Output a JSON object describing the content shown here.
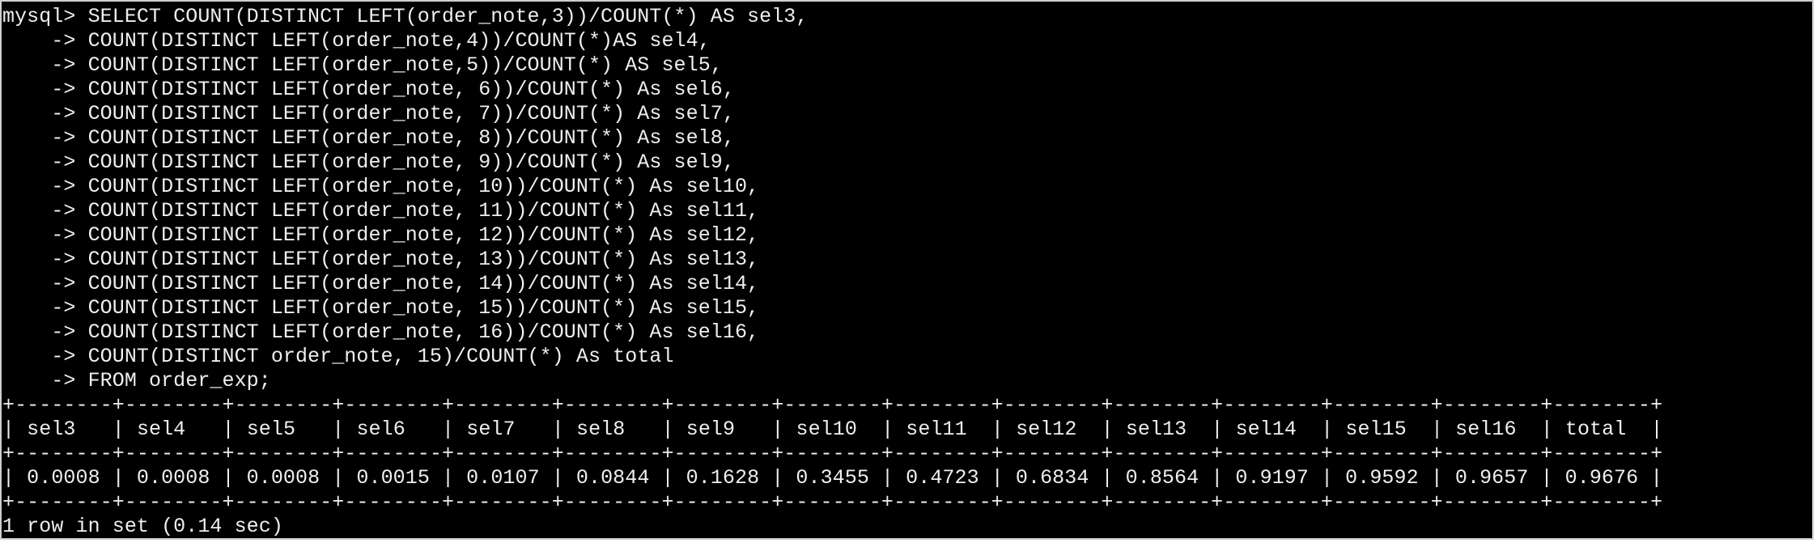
{
  "terminal": {
    "prompt": "mysql> ",
    "continuation_prompt": "    -> ",
    "query_lines": [
      "SELECT COUNT(DISTINCT LEFT(order_note,3))/COUNT(*) AS sel3,",
      "COUNT(DISTINCT LEFT(order_note,4))/COUNT(*)AS sel4,",
      "COUNT(DISTINCT LEFT(order_note,5))/COUNT(*) AS sel5,",
      "COUNT(DISTINCT LEFT(order_note, 6))/COUNT(*) As sel6,",
      "COUNT(DISTINCT LEFT(order_note, 7))/COUNT(*) As sel7,",
      "COUNT(DISTINCT LEFT(order_note, 8))/COUNT(*) As sel8,",
      "COUNT(DISTINCT LEFT(order_note, 9))/COUNT(*) As sel9,",
      "COUNT(DISTINCT LEFT(order_note, 10))/COUNT(*) As sel10,",
      "COUNT(DISTINCT LEFT(order_note, 11))/COUNT(*) As sel11,",
      "COUNT(DISTINCT LEFT(order_note, 12))/COUNT(*) As sel12,",
      "COUNT(DISTINCT LEFT(order_note, 13))/COUNT(*) As sel13,",
      "COUNT(DISTINCT LEFT(order_note, 14))/COUNT(*) As sel14,",
      "COUNT(DISTINCT LEFT(order_note, 15))/COUNT(*) As sel15,",
      "COUNT(DISTINCT LEFT(order_note, 16))/COUNT(*) As sel16,",
      "COUNT(DISTINCT order_note, 15)/COUNT(*) As total",
      "FROM order_exp;"
    ],
    "result_table": {
      "columns": [
        "sel3",
        "sel4",
        "sel5",
        "sel6",
        "sel7",
        "sel8",
        "sel9",
        "sel10",
        "sel11",
        "sel12",
        "sel13",
        "sel14",
        "sel15",
        "sel16",
        "total"
      ],
      "rows": [
        [
          "0.0008",
          "0.0008",
          "0.0008",
          "0.0015",
          "0.0107",
          "0.0844",
          "0.1628",
          "0.3455",
          "0.4723",
          "0.6834",
          "0.8564",
          "0.9197",
          "0.9592",
          "0.9657",
          "0.9676"
        ]
      ]
    },
    "status": "1 row in set (0.14 sec)"
  }
}
